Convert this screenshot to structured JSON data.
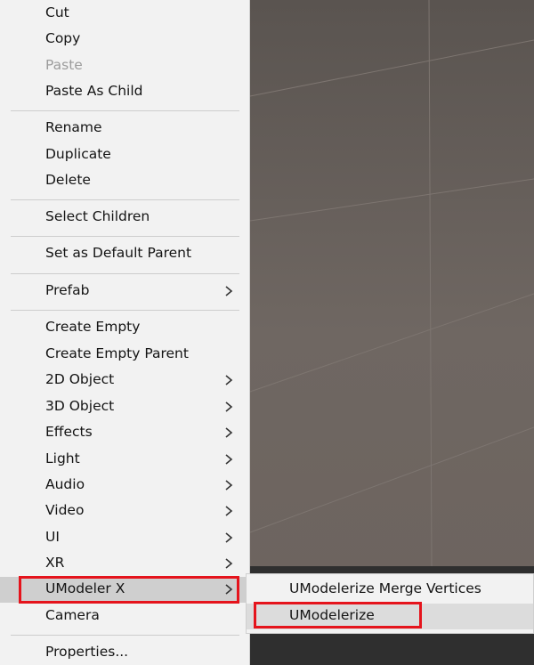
{
  "context_menu": {
    "items": [
      {
        "label": "Cut",
        "enabled": true,
        "has_submenu": false
      },
      {
        "label": "Copy",
        "enabled": true,
        "has_submenu": false
      },
      {
        "label": "Paste",
        "enabled": false,
        "has_submenu": false
      },
      {
        "label": "Paste As Child",
        "enabled": true,
        "has_submenu": false
      },
      {
        "label": "Rename",
        "enabled": true,
        "has_submenu": false
      },
      {
        "label": "Duplicate",
        "enabled": true,
        "has_submenu": false
      },
      {
        "label": "Delete",
        "enabled": true,
        "has_submenu": false
      },
      {
        "label": "Select Children",
        "enabled": true,
        "has_submenu": false
      },
      {
        "label": "Set as Default Parent",
        "enabled": true,
        "has_submenu": false
      },
      {
        "label": "Prefab",
        "enabled": true,
        "has_submenu": true
      },
      {
        "label": "Create Empty",
        "enabled": true,
        "has_submenu": false
      },
      {
        "label": "Create Empty Parent",
        "enabled": true,
        "has_submenu": false
      },
      {
        "label": "2D Object",
        "enabled": true,
        "has_submenu": true
      },
      {
        "label": "3D Object",
        "enabled": true,
        "has_submenu": true
      },
      {
        "label": "Effects",
        "enabled": true,
        "has_submenu": true
      },
      {
        "label": "Light",
        "enabled": true,
        "has_submenu": true
      },
      {
        "label": "Audio",
        "enabled": true,
        "has_submenu": true
      },
      {
        "label": "Video",
        "enabled": true,
        "has_submenu": true
      },
      {
        "label": "UI",
        "enabled": true,
        "has_submenu": true
      },
      {
        "label": "XR",
        "enabled": true,
        "has_submenu": true
      },
      {
        "label": "UModeler X",
        "enabled": true,
        "has_submenu": true,
        "selected": true
      },
      {
        "label": "Camera",
        "enabled": true,
        "has_submenu": false
      },
      {
        "label": "Properties...",
        "enabled": true,
        "has_submenu": false
      }
    ]
  },
  "submenu": {
    "items": [
      {
        "label": "UModelerize Merge Vertices"
      },
      {
        "label": "UModelerize",
        "hovered": true
      }
    ]
  },
  "colors": {
    "menu_bg": "#f2f2f2",
    "highlight_box": "#e5141c",
    "scene_bg": "#6b645f"
  }
}
